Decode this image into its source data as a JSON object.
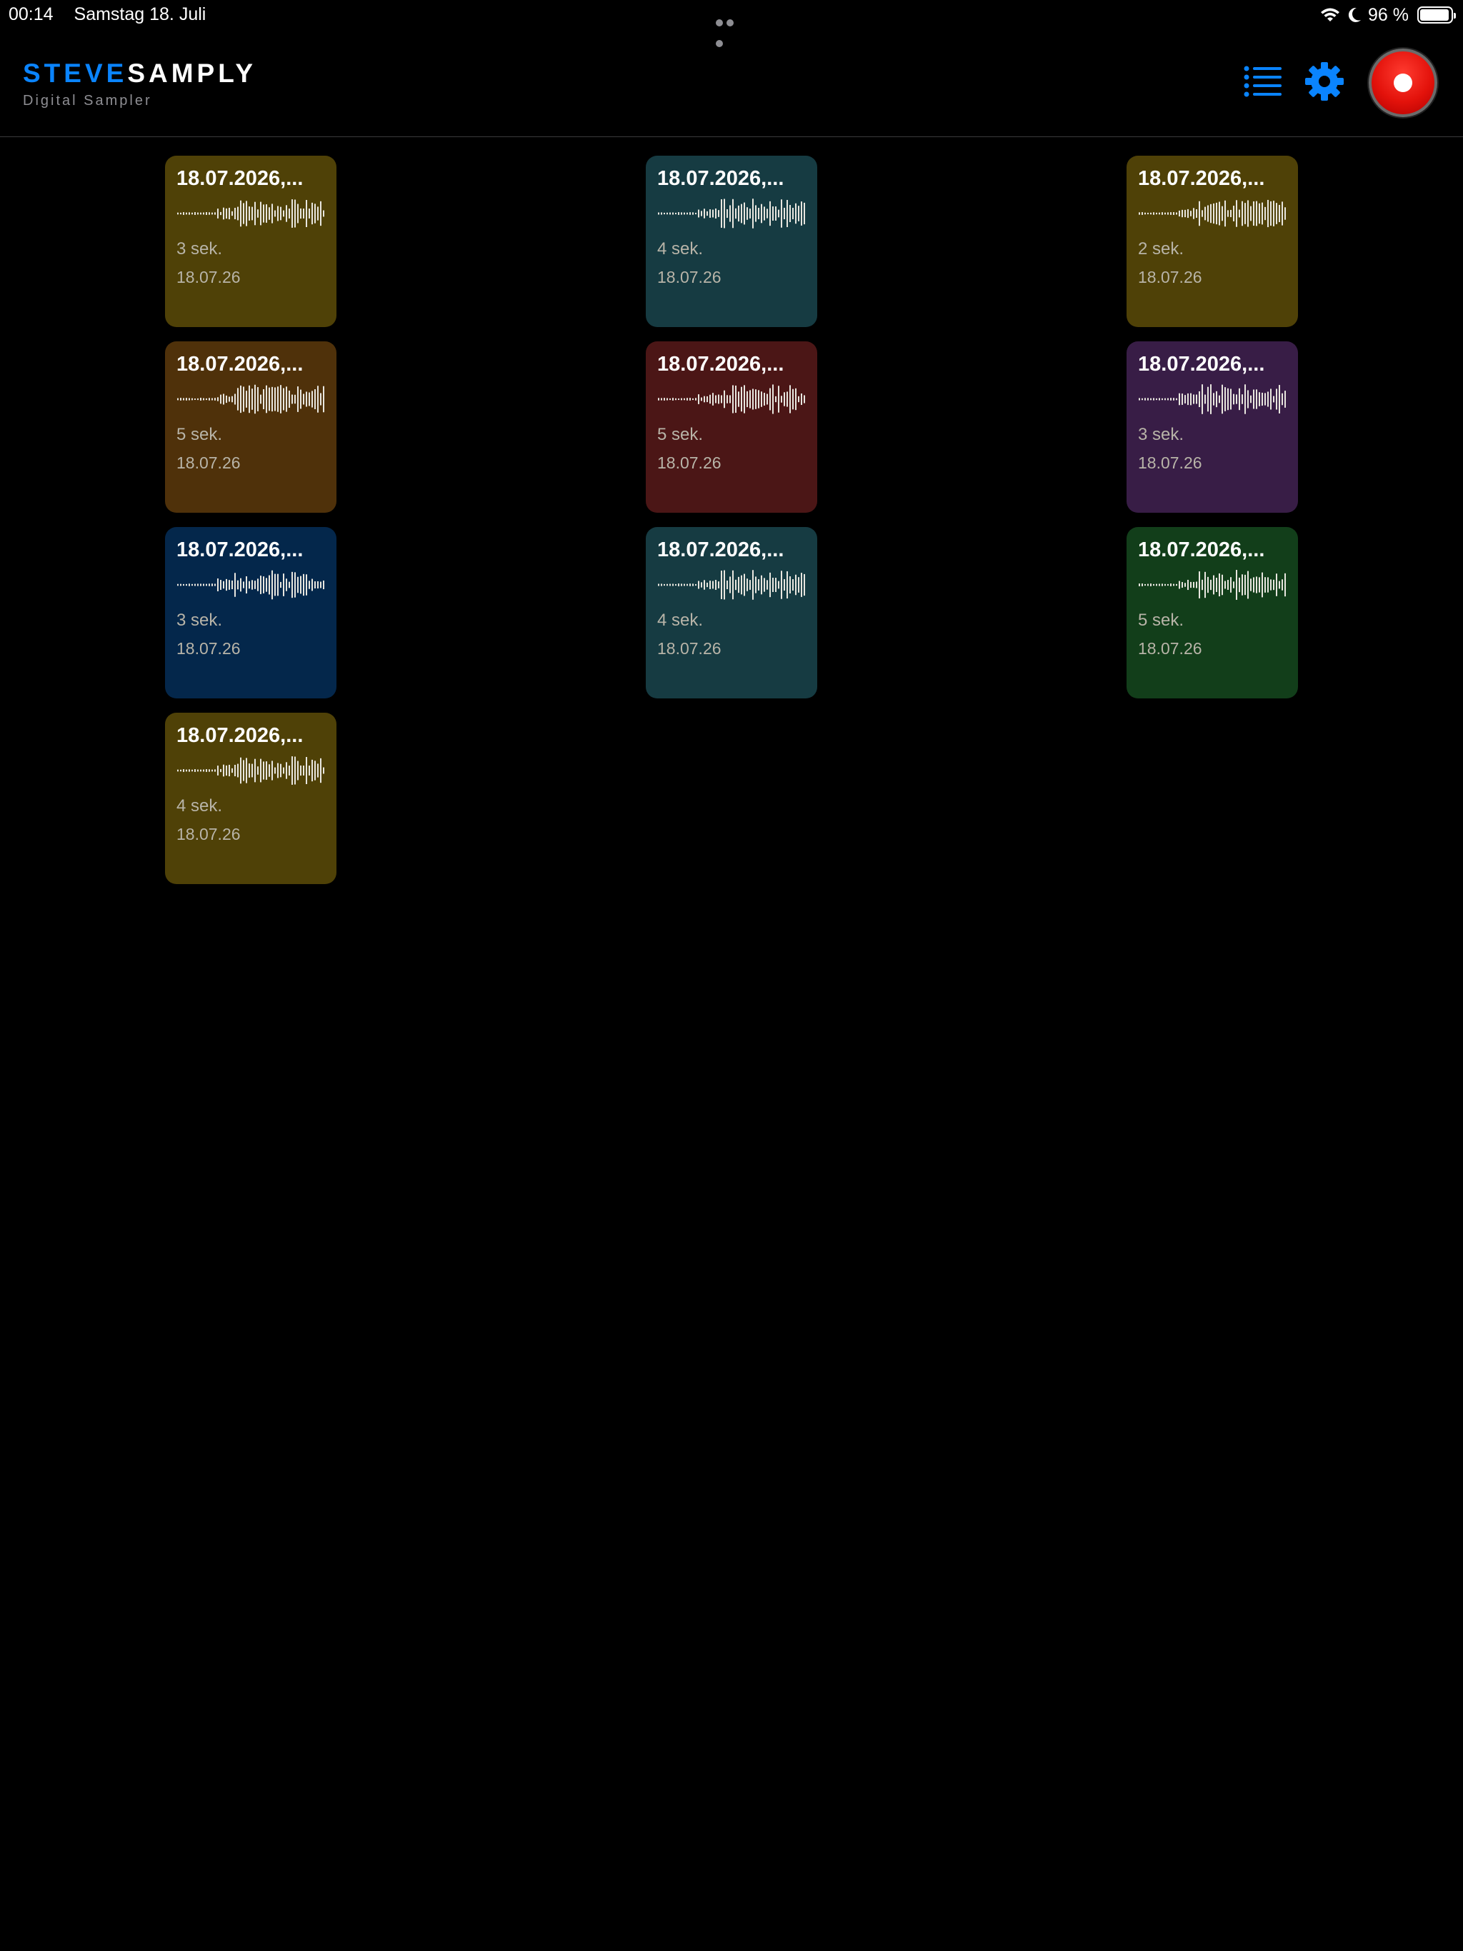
{
  "status_bar": {
    "time": "00:14",
    "date": "Samstag 18. Juli",
    "battery_percent": "96 %",
    "battery_level": 0.96,
    "icons": [
      "wifi-icon",
      "moon-icon",
      "battery-icon"
    ]
  },
  "header": {
    "brand_part1": "STEVE",
    "brand_part2": "SAMPLY",
    "subtitle": "Digital Sampler",
    "icons": [
      "list-icon",
      "gear-icon",
      "record-icon"
    ]
  },
  "colors": {
    "accent": "#0a84ff",
    "record": "#e3120b"
  },
  "samples": [
    {
      "title": "18.07.2026,...",
      "duration": "3 sek.",
      "date": "18.07.26",
      "color": "#4f4107"
    },
    {
      "title": "18.07.2026,...",
      "duration": "4 sek.",
      "date": "18.07.26",
      "color": "#163b42"
    },
    {
      "title": "18.07.2026,...",
      "duration": "2 sek.",
      "date": "18.07.26",
      "color": "#4f4107"
    },
    {
      "title": "18.07.2026,...",
      "duration": "5 sek.",
      "date": "18.07.26",
      "color": "#4f310a"
    },
    {
      "title": "18.07.2026,...",
      "duration": "5 sek.",
      "date": "18.07.26",
      "color": "#4b1616"
    },
    {
      "title": "18.07.2026,...",
      "duration": "3 sek.",
      "date": "18.07.26",
      "color": "#381d46"
    },
    {
      "title": "18.07.2026,...",
      "duration": "3 sek.",
      "date": "18.07.26",
      "color": "#04274b"
    },
    {
      "title": "18.07.2026,...",
      "duration": "4 sek.",
      "date": "18.07.26",
      "color": "#163b42"
    },
    {
      "title": "18.07.2026,...",
      "duration": "5 sek.",
      "date": "18.07.26",
      "color": "#123e1a"
    },
    {
      "title": "18.07.2026,...",
      "duration": "4 sek.",
      "date": "18.07.26",
      "color": "#4f4107"
    }
  ]
}
